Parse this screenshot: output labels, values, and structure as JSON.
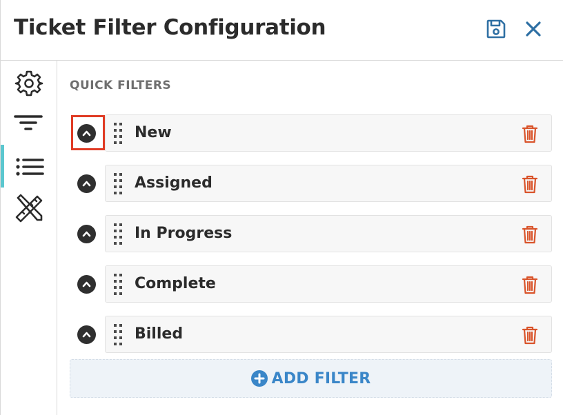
{
  "header": {
    "title": "Ticket Filter Configuration",
    "save_icon": "save-icon",
    "close_icon": "close-icon"
  },
  "rail": {
    "items": [
      {
        "icon": "gear-icon",
        "active": false
      },
      {
        "icon": "filter-icon",
        "active": false
      },
      {
        "icon": "list-icon",
        "active": true
      },
      {
        "icon": "tools-icon",
        "active": false
      }
    ],
    "accent_color": "#5bc7cf"
  },
  "main": {
    "section_label": "QUICK FILTERS",
    "filters": [
      {
        "label": "New",
        "focused": true
      },
      {
        "label": "Assigned",
        "focused": false
      },
      {
        "label": "In Progress",
        "focused": false
      },
      {
        "label": "Complete",
        "focused": false
      },
      {
        "label": "Billed",
        "focused": false
      }
    ],
    "add_filter_label": "ADD FILTER"
  },
  "colors": {
    "icon_blue": "#2e6fa3",
    "trash_red": "#d9542b",
    "add_blue": "#3a86c8",
    "focus_red": "#e03b24"
  }
}
